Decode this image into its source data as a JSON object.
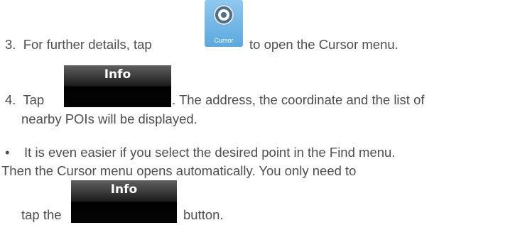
{
  "step3": {
    "number": "3.",
    "before": "For further details, tap",
    "after": "to open the Cursor menu."
  },
  "cursor_button": {
    "label": "Cursor",
    "icon": "cursor-target-icon",
    "color": "#6cb4e6"
  },
  "step4": {
    "number": "4.",
    "before": "Tap",
    "after": ". The address, the coordinate and the list of",
    "line2": "nearby POIs will be displayed."
  },
  "info_button": {
    "label": "Info",
    "color": "#000000"
  },
  "bullet": {
    "mark": "•",
    "line1": "It is even easier if you select the desired point in the Find menu.",
    "line2": "Then the Cursor menu opens automatically. You only need to",
    "line3_before": "tap the",
    "line3_after": "button."
  }
}
